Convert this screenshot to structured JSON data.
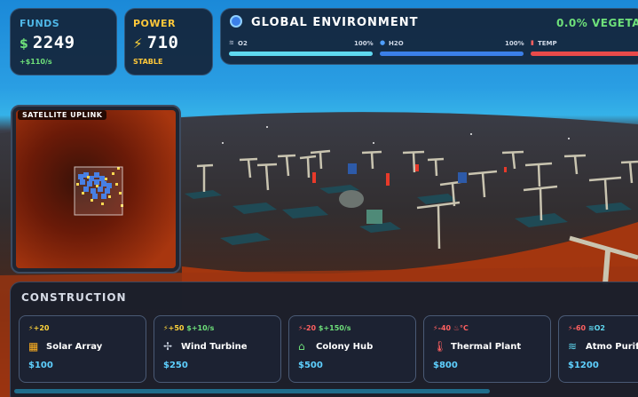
{
  "funds": {
    "label": "FUNDS",
    "currency": "$",
    "value": "2249",
    "rate": "+$110/s"
  },
  "power": {
    "label": "POWER",
    "icon": "lightning-icon",
    "value": "710",
    "status": "STABLE"
  },
  "environment": {
    "title": "GLOBAL ENVIRONMENT",
    "vegetation": "0.0% VEGETA",
    "bars": [
      {
        "label": "O2",
        "value": "100%",
        "fill": 1.0,
        "color": "#5fd8f0"
      },
      {
        "label": "H2O",
        "value": "100%",
        "fill": 1.0,
        "color": "#3b7fe8"
      },
      {
        "label": "TEMP",
        "value": "",
        "fill": 1.0,
        "color": "#e84a4a"
      }
    ]
  },
  "satellite": {
    "title": "SATELLITE UPLINK"
  },
  "construction": {
    "title": "CONSTRUCTION",
    "cards": [
      {
        "stats": [
          {
            "icon": "lightning-icon",
            "text": "+20",
            "color": "#ffd43a"
          }
        ],
        "icon": "solar-panel-icon",
        "icon_color": "#ffb020",
        "name": "Solar Array",
        "price": "$100"
      },
      {
        "stats": [
          {
            "icon": "lightning-icon",
            "text": "+50",
            "color": "#ffd43a"
          },
          {
            "icon": "dollar-icon",
            "text": "+10/s",
            "color": "#6ee07a"
          }
        ],
        "icon": "fan-icon",
        "icon_color": "#d0d8e6",
        "name": "Wind Turbine",
        "price": "$250"
      },
      {
        "stats": [
          {
            "icon": "lightning-icon",
            "text": "-20",
            "color": "#ff6060"
          },
          {
            "icon": "dollar-icon",
            "text": "+150/s",
            "color": "#6ee07a"
          }
        ],
        "icon": "home-icon",
        "icon_color": "#6ee07a",
        "name": "Colony Hub",
        "price": "$500"
      },
      {
        "stats": [
          {
            "icon": "lightning-icon",
            "text": "-40",
            "color": "#ff6060"
          },
          {
            "icon": "fire-icon",
            "text": "°C",
            "color": "#ff6060"
          }
        ],
        "icon": "temperature-icon",
        "icon_color": "#ff6060",
        "name": "Thermal Plant",
        "price": "$800"
      },
      {
        "stats": [
          {
            "icon": "lightning-icon",
            "text": "-60",
            "color": "#ff6060"
          },
          {
            "icon": "wind-icon",
            "text": "O2",
            "color": "#5fd8f0"
          }
        ],
        "icon": "wind-icon",
        "icon_color": "#5fd8f0",
        "name": "Atmo Purifier",
        "price": "$1200"
      }
    ]
  }
}
